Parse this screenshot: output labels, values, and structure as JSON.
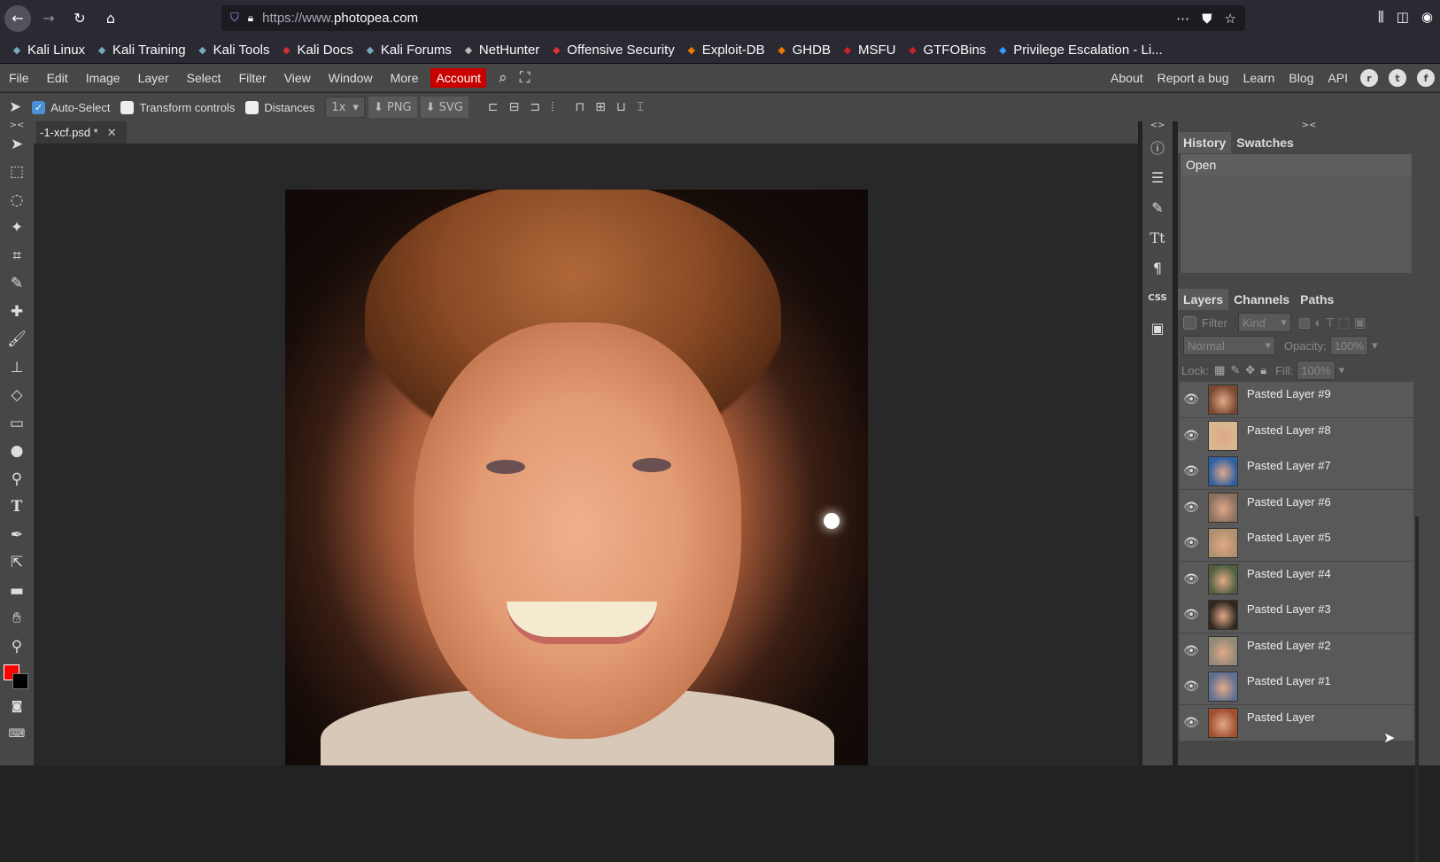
{
  "browser": {
    "url_prefix": "https://www.",
    "url_host": "photopea.com",
    "bookmarks": [
      {
        "label": "Kali Linux",
        "icon": "kali-icon"
      },
      {
        "label": "Kali Training",
        "icon": "kali-icon"
      },
      {
        "label": "Kali Tools",
        "icon": "kali-icon"
      },
      {
        "label": "Kali Docs",
        "icon": "kali-docs-icon"
      },
      {
        "label": "Kali Forums",
        "icon": "kali-icon"
      },
      {
        "label": "NetHunter",
        "icon": "nethunter-icon"
      },
      {
        "label": "Offensive Security",
        "icon": "offsec-icon"
      },
      {
        "label": "Exploit-DB",
        "icon": "exploitdb-icon"
      },
      {
        "label": "GHDB",
        "icon": "ghdb-icon"
      },
      {
        "label": "MSFU",
        "icon": "msfu-icon"
      },
      {
        "label": "GTFOBins",
        "icon": "gtfobins-icon"
      },
      {
        "label": "Privilege Escalation - Li...",
        "icon": "privesc-icon"
      }
    ]
  },
  "menubar": {
    "items": [
      "File",
      "Edit",
      "Image",
      "Layer",
      "Select",
      "Filter",
      "View",
      "Window",
      "More"
    ],
    "account": "Account",
    "right": [
      "About",
      "Report a bug",
      "Learn",
      "Blog",
      "API"
    ]
  },
  "options": {
    "auto_select": "Auto-Select",
    "transform_controls": "Transform controls",
    "distances": "Distances",
    "scale": "1x",
    "png": "PNG",
    "svg": "SVG"
  },
  "document": {
    "tab_title": "-1-xcf.psd *"
  },
  "history_panel": {
    "tabs": [
      "History",
      "Swatches"
    ],
    "items": [
      "Open"
    ]
  },
  "layers_panel": {
    "tabs": [
      "Layers",
      "Channels",
      "Paths"
    ],
    "filter_label": "Filter",
    "kind": "Kind",
    "blend_mode": "Normal",
    "opacity_label": "Opacity:",
    "opacity": "100%",
    "lock_label": "Lock:",
    "fill_label": "Fill:",
    "fill": "100%",
    "layers": [
      {
        "name": "Pasted Layer #9",
        "thumb": "#7a4a30"
      },
      {
        "name": "Pasted Layer #8",
        "thumb": "#d8b890"
      },
      {
        "name": "Pasted Layer #7",
        "thumb": "#3060a0"
      },
      {
        "name": "Pasted Layer #6",
        "thumb": "#8a7060"
      },
      {
        "name": "Pasted Layer #5",
        "thumb": "#b09070"
      },
      {
        "name": "Pasted Layer #4",
        "thumb": "#506040"
      },
      {
        "name": "Pasted Layer #3",
        "thumb": "#302820"
      },
      {
        "name": "Pasted Layer #2",
        "thumb": "#908878"
      },
      {
        "name": "Pasted Layer #1",
        "thumb": "#607090"
      },
      {
        "name": "Pasted Layer",
        "thumb": "#a05030"
      }
    ]
  },
  "colors": {
    "foreground": "#ff0000",
    "background": "#000000",
    "account_bg": "#c80000"
  }
}
